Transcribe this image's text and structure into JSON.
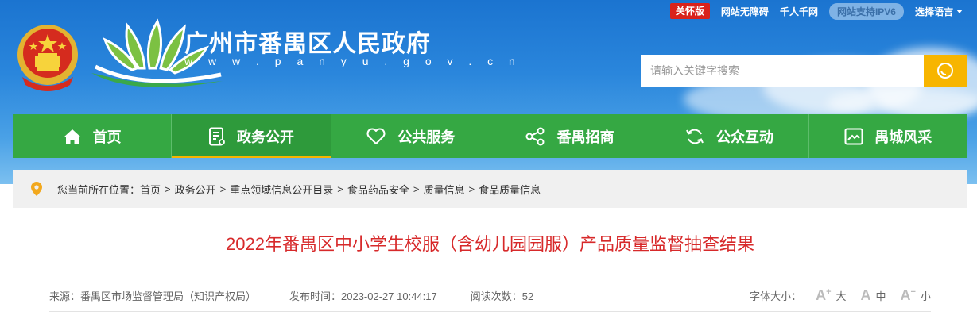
{
  "topbar": {
    "care_label": "关怀版",
    "accessibility_label": "网站无障碍",
    "thousand_label": "千人千网",
    "ipv6_label": "网站支持IPV6",
    "language_label": "选择语言"
  },
  "site": {
    "title": "广州市番禺区人民政府",
    "url": "w w w . p a n y u . g o v . c n"
  },
  "search": {
    "placeholder": "请输入关键字搜索",
    "icon": "search-icon"
  },
  "nav": {
    "items": [
      {
        "label": "首页",
        "icon": "home-icon"
      },
      {
        "label": "政务公开",
        "icon": "document-icon",
        "active": true
      },
      {
        "label": "公共服务",
        "icon": "heart-icon"
      },
      {
        "label": "番禺招商",
        "icon": "share-icon"
      },
      {
        "label": "公众互动",
        "icon": "refresh-icon"
      },
      {
        "label": "禺城风采",
        "icon": "picture-icon"
      }
    ]
  },
  "breadcrumb": {
    "prefix": "您当前所在位置：",
    "items": [
      "首页",
      "政务公开",
      "重点领域信息公开目录",
      "食品药品安全",
      "质量信息",
      "食品质量信息"
    ],
    "separator": ">"
  },
  "article": {
    "title": "2022年番禺区中小学生校服（含幼儿园园服）产品质量监督抽查结果",
    "source": "来源：番禺区市场监督管理局（知识产权局）",
    "published": "发布时间：2023-02-27 10:44:17",
    "views": "阅读次数：52",
    "font_size_label": "字体大小：",
    "font_sizes": [
      {
        "glyph": "A",
        "mark": "+",
        "label": "大"
      },
      {
        "glyph": "A",
        "mark": "",
        "label": "中"
      },
      {
        "glyph": "A",
        "mark": "−",
        "label": "小"
      }
    ]
  },
  "colors": {
    "nav_green": "#35a843",
    "accent_yellow": "#f7b500",
    "title_red": "#d7292a",
    "care_red": "#d9221c"
  }
}
